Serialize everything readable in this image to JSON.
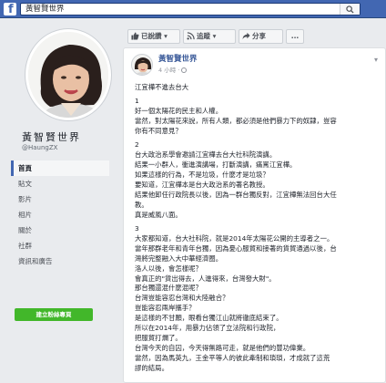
{
  "search": {
    "query": "黃智賢世界"
  },
  "profile": {
    "name": "黃智賢世界",
    "handle": "@HaungZX"
  },
  "nav": [
    {
      "label": "首頁",
      "active": true
    },
    {
      "label": "貼文"
    },
    {
      "label": "影片"
    },
    {
      "label": "相片"
    },
    {
      "label": "關於"
    },
    {
      "label": "社群"
    },
    {
      "label": "資訊和廣告"
    }
  ],
  "create_page_label": "建立粉絲專頁",
  "actions": {
    "liked": "已說讚",
    "follow": "追蹤",
    "share": "分享",
    "more": "..."
  },
  "post": {
    "author": "黃智賢世界",
    "time": "4 小時",
    "paragraphs": [
      [
        "江宜樺不進去台大"
      ],
      [
        "1",
        "好一個太陽花的民主和人權。",
        "當然，對太陽花來說，所有人類，都必須是他們暴力下的奴隸，豈容",
        "你有不同意見？"
      ],
      [
        "2",
        "台大政治系學會邀請江宜樺去台大社科院演講。",
        "結果一小群人，衝進演講場，打斷演講，痛罵江宜樺。",
        "如果這樣的行為，不是垃圾，什麼才是垃圾？",
        "要知道，江宜樺本是台大政治系的著名教授。",
        "結果他卸任行政院長以後，因為一群台獨反對，江宜樺無法回台大任",
        "教。",
        "真是威風八面。"
      ],
      [
        "3",
        "大家都知道，台大社科院，就是2014年太陽花公開的主導者之一。",
        "當年那群老年和青年台獨，因為憂心服貿和接著的貨貿通過以後，台",
        "灣將完整融入大中華經濟圈。",
        "洛人以後，會怎樣呢？",
        "會真正的\"貨出得去，人進得來，台灣發大財\"。",
        "那台獨還混什麼混呢？",
        "台灣豈能容忍台灣和大陸融合？",
        "豈能容忍兩岸攜手？",
        "是這樣的不甘願，眼看台獨江山就將徹底結束了。",
        "所以在2014年，用暴力佔領了立法院和行政院，",
        "把服貿打爛了。",
        "台灣今天的自囚，今天得無路可走，就是他們的豐功偉業。",
        "當然，因為馬英九，王金平等人的彼此牽制和瑣瑣，才成就了這荒",
        "謬的結局。"
      ]
    ]
  }
}
